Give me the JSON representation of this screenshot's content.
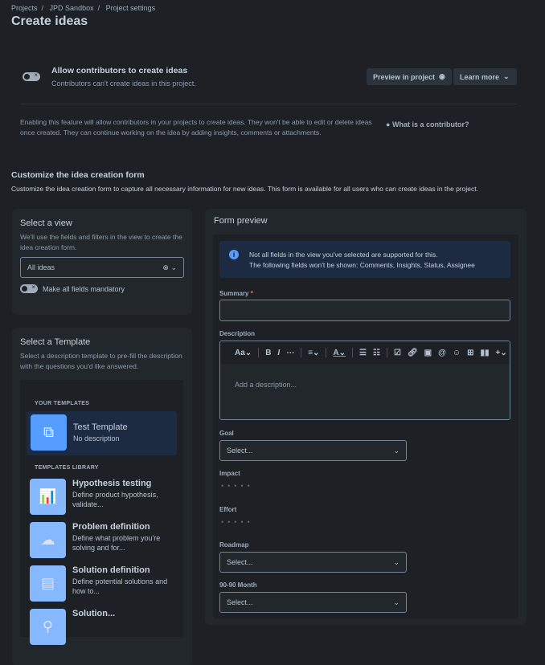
{
  "breadcrumb": [
    "Projects",
    "JPD Sandbox",
    "Project settings"
  ],
  "title": "Create ideas",
  "allow": {
    "title": "Allow contributors to create ideas",
    "subtitle": "Contributors can't create ideas in this project.",
    "enabled": false
  },
  "buttons": {
    "preview": "Preview in project",
    "learn": "Learn more"
  },
  "info_text": "Enabling this feature will allow contributors in your projects to create ideas. They won't be able to edit or delete ideas once created. They can continue working on the idea by adding insights, comments or attachments.",
  "contributor_link": "What is a contributor?",
  "customize": {
    "title": "Customize the idea creation form",
    "subtitle": "Customize the idea creation form to capture all necessary information for new ideas. This form is available for all users who can create ideas in the project."
  },
  "view": {
    "title": "Select a view",
    "desc": "We'll use the fields and filters in the view to create the idea creation form.",
    "selected": "All ideas",
    "mandatory_label": "Make all fields mandatory"
  },
  "templates": {
    "title": "Select a Template",
    "desc": "Select a description template to pre-fill the description with the questions you'd like answered.",
    "your_label": "YOUR TEMPLATES",
    "library_label": "TEMPLATES LIBRARY",
    "yours": [
      {
        "name": "Test Template",
        "desc": "No description"
      }
    ],
    "library": [
      {
        "name": "Hypothesis testing",
        "desc": "Define product hypothesis, validate..."
      },
      {
        "name": "Problem definition",
        "desc": "Define what problem you're solving and for..."
      },
      {
        "name": "Solution definition",
        "desc": "Define potential solutions and how to..."
      },
      {
        "name": "Solution...",
        "desc": ""
      }
    ]
  },
  "preview": {
    "title": "Form preview",
    "notice1": "Not all fields in the view you've selected are supported for this.",
    "notice2": "The following fields won't be shown: Comments, Insights, Status, Assignee",
    "summary_label": "Summary",
    "required": "*",
    "description_label": "Description",
    "desc_placeholder": "Add a description...",
    "toolbar_text_style": "Aa",
    "goal_label": "Goal",
    "impact_label": "Impact",
    "effort_label": "Effort",
    "roadmap_label": "Roadmap",
    "month_label": "90-90 Month",
    "select_placeholder": "Select..."
  }
}
